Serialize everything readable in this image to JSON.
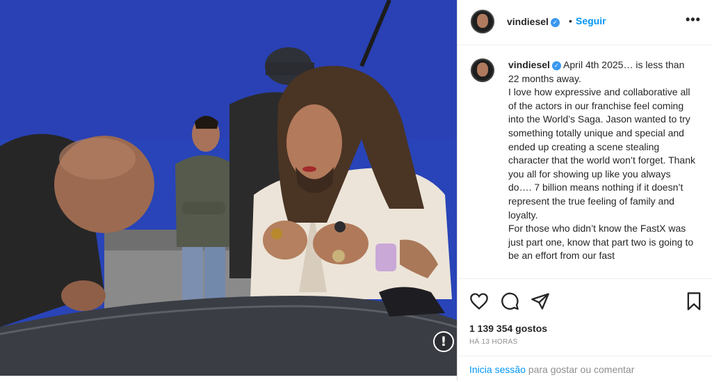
{
  "post": {
    "username": "vindiesel",
    "verified_icon": "verified-badge-icon",
    "follow_separator": "•",
    "follow_label": "Seguir",
    "more_label": "•••",
    "caption": "April 4th 2025… is less than 22 months away.\nI love how expressive and collaborative all of the actors in our franchise feel coming into the World’s Saga. Jason wanted to try something totally unique and special and ended up creating a scene stealing character that the world won’t forget. Thank you all for showing up like you always do…. 7 billion means nothing if it doesn’t represent the true feeling of family and loyalty.\nFor those who didn’t know the FastX was just part one, know that part two is going to be an effort from our fast",
    "likes": "1 139 354 gostos",
    "time": "HÁ 13 HORAS",
    "login_link": "Inicia sessão",
    "login_rest": " para gostar ou comentar",
    "alt_badge": "!",
    "icons": {
      "like": "heart-icon",
      "comment": "comment-icon",
      "share": "send-icon",
      "save": "bookmark-icon"
    }
  },
  "colors": {
    "link_blue": "#0095f6",
    "backdrop_blue": "#2745b9",
    "verified_blue": "#3897f0"
  }
}
